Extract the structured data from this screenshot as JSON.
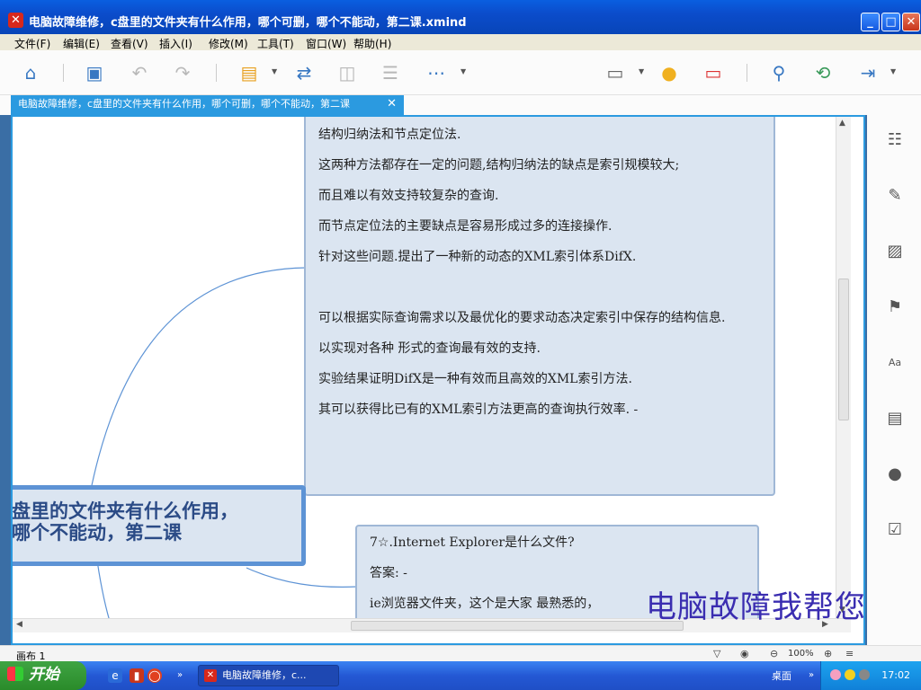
{
  "window": {
    "title": "电脑故障维修，c盘里的文件夹有什么作用，哪个可删，哪个不能动，第二课.xmind",
    "app_icon": "xmind-x-icon",
    "minimize": "_",
    "maximize": "□",
    "close": "✕"
  },
  "menu": [
    "文件(F)",
    "编辑(E)",
    "查看(V)",
    "插入(I)",
    "修改(M)",
    "工具(T)",
    "窗口(W)",
    "帮助(H)"
  ],
  "toolbar": {
    "icons": [
      "home-icon",
      "save-icon",
      "undo-icon",
      "redo-icon",
      "topic-icon",
      "relationship-icon",
      "boundary-icon",
      "summary-icon",
      "more-icon",
      "presentation-icon",
      "idea-icon",
      "gantt-icon",
      "search-icon",
      "share-icon",
      "export-icon"
    ]
  },
  "tab": {
    "label": "电脑故障维修，c盘里的文件夹有什么作用，哪个可删，哪个不能动，第二课",
    "close": "✕"
  },
  "topic1": {
    "lines": [
      "结构归纳法和节点定位法.",
      "这两种方法都存在一定的问题,结构归纳法的缺点是索引规模较大;",
      " 而且难以有效支持较复杂的查询.",
      "而节点定位法的主要缺点是容易形成过多的连接操作.",
      "针对这些问题.提出了一种新的动态的XML索引体系DifX.",
      "",
      "可以根据实际查询需求以及最优化的要求动态决定索引中保存的结构信息.",
      "以实现对各种 形式的查询最有效的支持.",
      "实验结果证明DifX是一种有效而且高效的XML索引方法.",
      "其可以获得比已有的XML索引方法更高的查询执行效率. -"
    ]
  },
  "central_topic": {
    "line1": "盘里的文件夹有什么作用，",
    "line2": "哪个不能动，第二课"
  },
  "topic2": {
    "lines": [
      "7☆.Internet Explorer是什么文件?",
      "答案: -",
      "ie浏览器文件夹，这个是大家 最熟悉的，"
    ]
  },
  "watermark": "电脑故障我帮您",
  "right_panel": {
    "icons": [
      "outline-icon",
      "format-brush-icon",
      "image-icon",
      "marker-flag-icon",
      "text-style-icon",
      "notes-icon",
      "comment-icon",
      "task-clipboard-icon"
    ]
  },
  "statusbar": {
    "sheet": "画布 1",
    "zoom": "100%"
  },
  "taskbar": {
    "start": "开始",
    "task_item": "电脑故障维修，c...",
    "desktop": "桌面",
    "clock": "17:02"
  }
}
